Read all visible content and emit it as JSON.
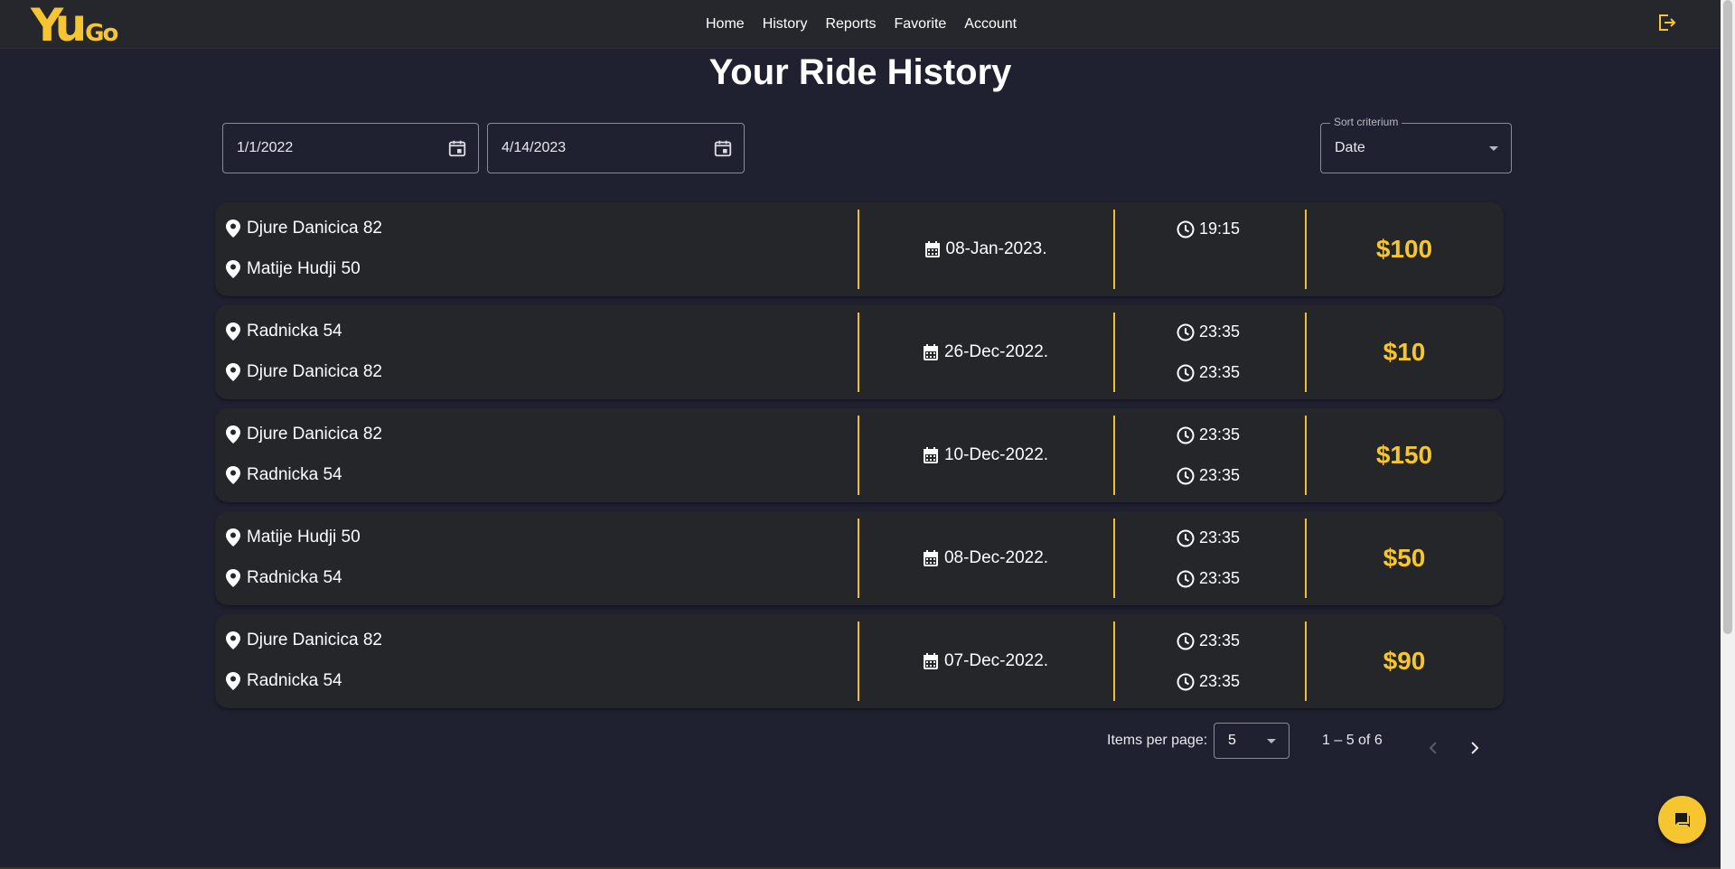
{
  "app": {
    "logo_text_big": "Yu",
    "logo_text_small": "Go",
    "brand_color": "#f6c631"
  },
  "nav": {
    "items": [
      "Home",
      "History",
      "Reports",
      "Favorite",
      "Account"
    ]
  },
  "page": {
    "title": "Your Ride History"
  },
  "filters": {
    "start_date": "1/1/2022",
    "end_date": "4/14/2023",
    "sort_label": "Sort criterium",
    "sort_value": "Date"
  },
  "rides": [
    {
      "from": "Djure Danicica 82",
      "to": "Matije Hudji 50",
      "date": "08-Jan-2023.",
      "start_time": "19:15",
      "end_time": "",
      "price": "$100"
    },
    {
      "from": "Radnicka 54",
      "to": "Djure Danicica 82",
      "date": "26-Dec-2022.",
      "start_time": "23:35",
      "end_time": "23:35",
      "price": "$10"
    },
    {
      "from": "Djure Danicica 82",
      "to": "Radnicka 54",
      "date": "10-Dec-2022.",
      "start_time": "23:35",
      "end_time": "23:35",
      "price": "$150"
    },
    {
      "from": "Matije Hudji 50",
      "to": "Radnicka 54",
      "date": "08-Dec-2022.",
      "start_time": "23:35",
      "end_time": "23:35",
      "price": "$50"
    },
    {
      "from": "Djure Danicica 82",
      "to": "Radnicka 54",
      "date": "07-Dec-2022.",
      "start_time": "23:35",
      "end_time": "23:35",
      "price": "$90"
    }
  ],
  "pagination": {
    "items_per_page_label": "Items per page:",
    "items_per_page": "5",
    "range": "1 – 5 of 6"
  },
  "icons": {
    "logout": "logout-icon",
    "calendar": "calendar-icon",
    "pin": "location-pin-icon",
    "clock": "clock-icon",
    "chat": "chat-icon"
  }
}
